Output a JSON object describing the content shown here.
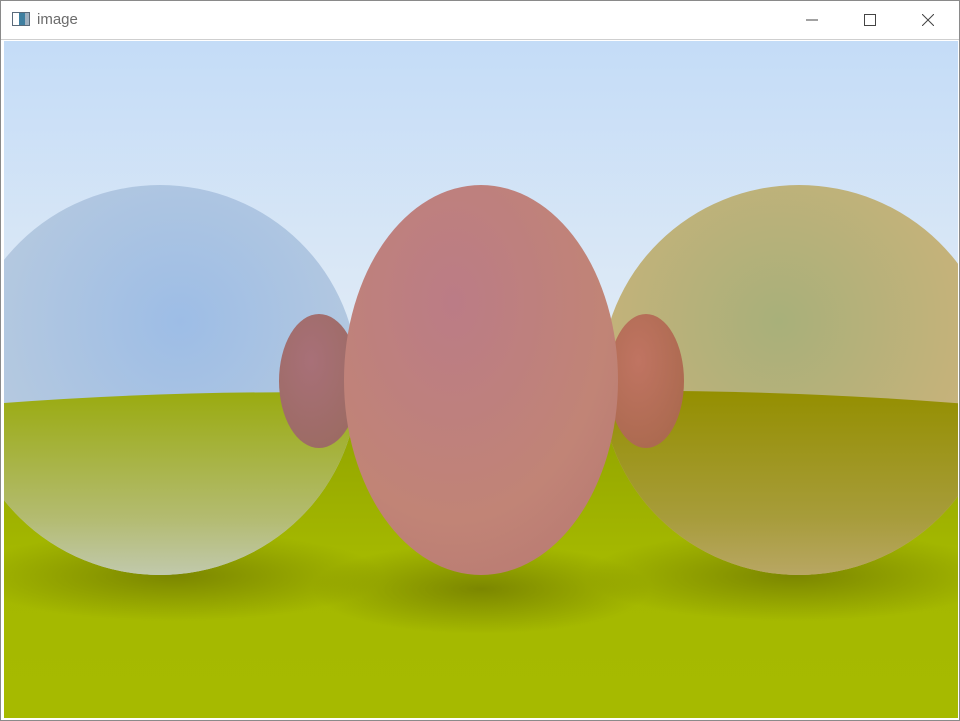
{
  "window": {
    "title": "image",
    "app_icon": "image-viewer-icon",
    "controls": {
      "minimize_icon": "minimize-icon",
      "maximize_icon": "maximize-icon",
      "close_icon": "close-icon"
    }
  },
  "scene": {
    "description_elements": [
      "sky",
      "ground-plane",
      "left-metal-sphere",
      "center-diffuse-sphere",
      "right-metal-sphere"
    ],
    "colors": {
      "sky_top": "#c4dcf7",
      "sky_horizon": "#e4eef8",
      "ground_near": "#a8bb00",
      "ground_far": "#94a800",
      "left_sphere": "#a9c3e2",
      "center_sphere": "#b97884",
      "right_sphere": "#c6b57a"
    }
  }
}
